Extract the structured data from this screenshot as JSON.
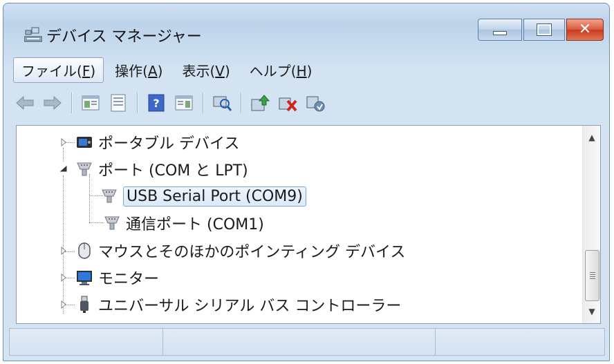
{
  "window": {
    "title": "デバイス マネージャー",
    "close_glyph": "✕"
  },
  "menu": [
    {
      "label": "ファイル(F)",
      "key": "F",
      "active": true
    },
    {
      "label": "操作(A)",
      "key": "A",
      "active": false
    },
    {
      "label": "表示(V)",
      "key": "V",
      "active": false
    },
    {
      "label": "ヘルプ(H)",
      "key": "H",
      "active": false
    }
  ],
  "toolbar": {
    "icons": [
      "back-arrow-icon",
      "forward-arrow-icon",
      "show-hide-console-tree-icon",
      "properties-icon",
      "help-icon",
      "action-pane-icon",
      "scan-hardware-icon",
      "update-driver-icon",
      "uninstall-icon",
      "disable-icon"
    ]
  },
  "tree": {
    "portable": "ポータブル デバイス",
    "ports": "ポート (COM と LPT)",
    "usb_serial": "USB Serial Port (COM9)",
    "comm_port": "通信ポート (COM1)",
    "mouse": "マウスとそのほかのポインティング デバイス",
    "monitor": "モニター",
    "usb_controllers": "ユニバーサル シリアル バス コントローラー"
  },
  "colors": {
    "accent": "#3c78c8",
    "close": "#c9381a",
    "selection": "#dbe9f9"
  }
}
